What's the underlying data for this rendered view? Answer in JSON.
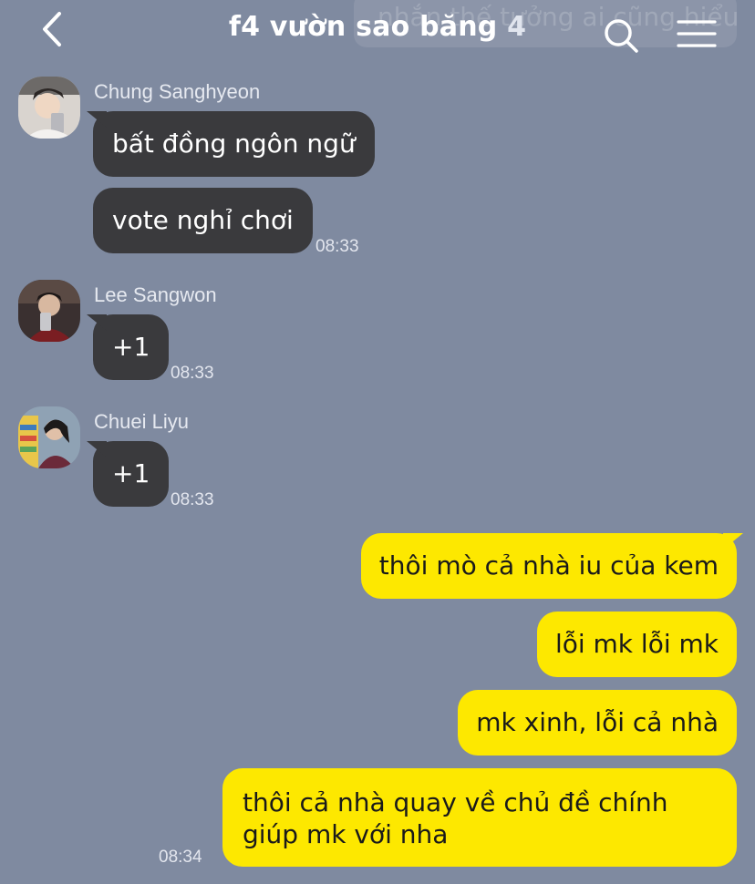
{
  "header": {
    "title": "f4 vườn sao băng",
    "member_count": "4",
    "ghost_text": "nhắn thế tưởng ai cũng hiểu",
    "icons": {
      "back": "chevron-left-icon",
      "search": "search-icon",
      "menu": "hamburger-menu-icon"
    }
  },
  "messages": [
    {
      "sender": "Chung Sanghyeon",
      "texts": [
        "bất đồng ngôn ngữ",
        "vote nghỉ chơi"
      ],
      "time": "08:33"
    },
    {
      "sender": "Lee Sangwon",
      "texts": [
        "+1"
      ],
      "time": "08:33"
    },
    {
      "sender": "Chuei Liyu",
      "texts": [
        "+1"
      ],
      "time": "08:33"
    }
  ],
  "outgoing": {
    "texts": [
      "thôi mò cả nhà iu của kem",
      "lỗi mk lỗi mk",
      "mk xinh, lỗi cả nhà",
      "thôi cả nhà quay về chủ đề chính giúp mk với nha"
    ],
    "time": "08:34"
  },
  "colors": {
    "background": "#7f8aa0",
    "incoming_bubble": "#3a3a3d",
    "outgoing_bubble": "#fde800"
  }
}
